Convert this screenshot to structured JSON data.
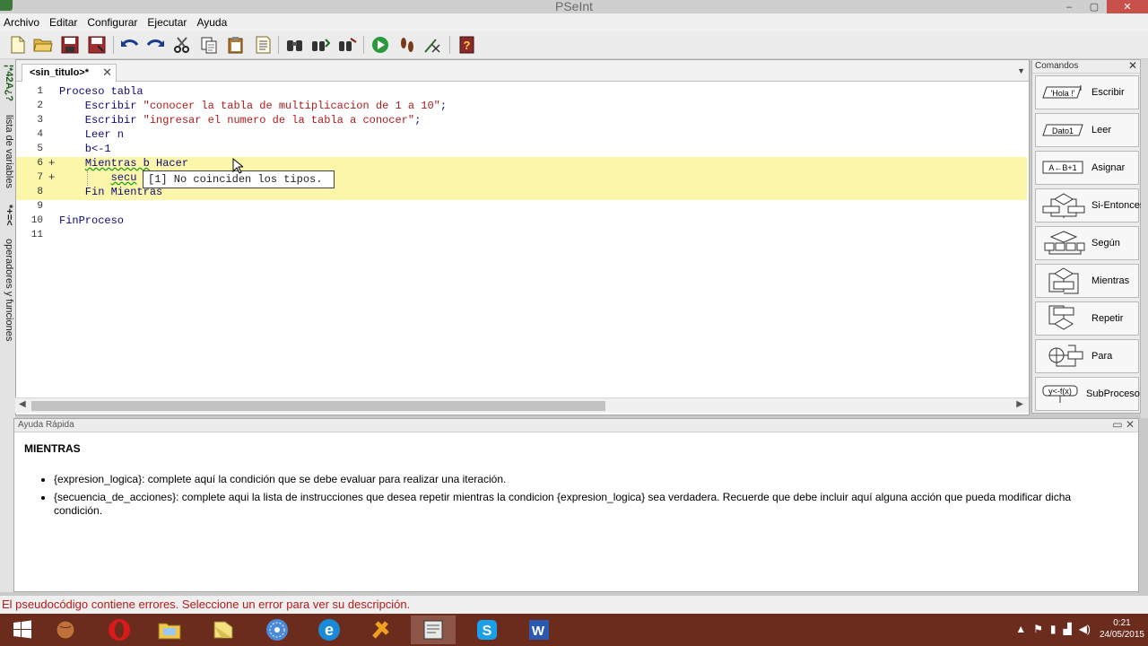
{
  "window": {
    "title": "PSeInt",
    "minimize": "–",
    "maximize": "▢",
    "close": "✕"
  },
  "menu": [
    "Archivo",
    "Editar",
    "Configurar",
    "Ejecutar",
    "Ayuda"
  ],
  "toolbar": {
    "buttons": [
      "new-file-icon",
      "open-folder-icon",
      "save-icon",
      "save-as-icon",
      "undo-icon",
      "redo-icon",
      "cut-icon",
      "copy-icon",
      "paste-icon",
      "indent-icon",
      "search-icon",
      "find-next-icon",
      "replace-icon",
      "run-icon",
      "step-icon",
      "debug-icon",
      "help-icon"
    ]
  },
  "left_panel": {
    "vars_tab": "lista de variables",
    "vars_symbols": "¦*42A¿?",
    "ops_symbols": "*+=<",
    "ops_tab": "operadores y funciones"
  },
  "editor": {
    "tab_label": "<sin_titulo>*",
    "tab_close": "✕",
    "lines": [
      {
        "num": "1",
        "fold": "",
        "parts": [
          {
            "t": "Proceso tabla",
            "c": "kw"
          }
        ]
      },
      {
        "num": "2",
        "fold": "",
        "parts": [
          {
            "t": "    Escribir ",
            "c": "kw"
          },
          {
            "t": "\"conocer la tabla de multiplicacion de 1 a 10\"",
            "c": "str"
          },
          {
            "t": ";",
            "c": "kw"
          }
        ]
      },
      {
        "num": "3",
        "fold": "",
        "parts": [
          {
            "t": "    Escribir ",
            "c": "kw"
          },
          {
            "t": "\"ingresar el numero de la tabla a conocer\"",
            "c": "str"
          },
          {
            "t": ";",
            "c": "kw"
          }
        ]
      },
      {
        "num": "4",
        "fold": "",
        "parts": [
          {
            "t": "    Leer n",
            "c": "kw"
          }
        ]
      },
      {
        "num": "5",
        "fold": "",
        "parts": [
          {
            "t": "    b<-1",
            "c": "kw"
          }
        ]
      },
      {
        "num": "6",
        "fold": "+",
        "hl": true,
        "parts": [
          {
            "t": "    ",
            "c": "kw"
          },
          {
            "t": "Mientras b",
            "c": "kw err"
          },
          {
            "t": " Hacer",
            "c": "kw"
          }
        ]
      },
      {
        "num": "7",
        "fold": "+",
        "hl": true,
        "parts": [
          {
            "t": "        ",
            "c": "kw"
          },
          {
            "t": "secu",
            "c": "kw err"
          }
        ]
      },
      {
        "num": "8",
        "fold": "",
        "hl": true,
        "parts": [
          {
            "t": "    Fin Mientras",
            "c": "kw"
          }
        ]
      },
      {
        "num": "9",
        "fold": "",
        "parts": []
      },
      {
        "num": "10",
        "fold": "",
        "parts": [
          {
            "t": "FinProceso",
            "c": "kw"
          }
        ]
      },
      {
        "num": "11",
        "fold": "",
        "parts": []
      }
    ],
    "tooltip": "[1] No coinciden los tipos."
  },
  "commands_panel": {
    "title": "Comandos",
    "close": "✕",
    "items": [
      {
        "label": "Escribir",
        "glyph": "'Hola !'"
      },
      {
        "label": "Leer",
        "glyph": "Dato1"
      },
      {
        "label": "Asignar",
        "glyph": "A←B+1"
      },
      {
        "label": "Si-Entonces",
        "glyph": ""
      },
      {
        "label": "Según",
        "glyph": ""
      },
      {
        "label": "Mientras",
        "glyph": ""
      },
      {
        "label": "Repetir",
        "glyph": ""
      },
      {
        "label": "Para",
        "glyph": ""
      },
      {
        "label": "SubProceso",
        "glyph": "y<-f(x)"
      }
    ]
  },
  "help_panel": {
    "header": "Ayuda Rápida",
    "controls": "▭ ✕",
    "title": "MIENTRAS",
    "items": [
      "{expresion_logica}: complete aquí la condición que se debe evaluar para realizar una iteración.",
      "{secuencia_de_acciones}: complete aqui la lista de instrucciones que desea repetir mientras la condicion {expresion_logica} sea verdadera. Recuerde que debe incluir aquí alguna acción que pueda modificar dicha condición."
    ]
  },
  "status": "El pseudocódigo contiene errores. Seleccione un error para ver su descripción.",
  "taskbar": {
    "clock_time": "0:21",
    "clock_date": "24/05/2015"
  }
}
